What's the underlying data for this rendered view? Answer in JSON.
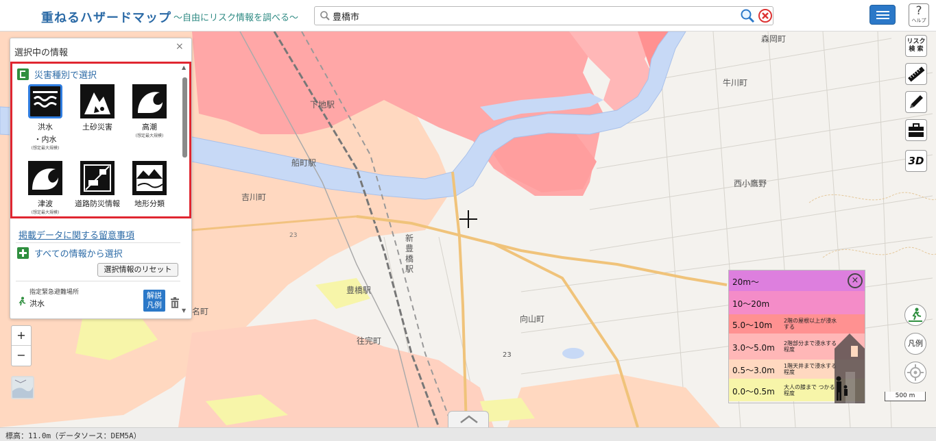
{
  "header": {
    "title": "重ねるハザードマップ",
    "subtitle": "～自由にリスク情報を調べる～",
    "search_value": "豊橋市",
    "help_label": "ヘルプ"
  },
  "panel": {
    "title": "選択中の情報",
    "close_label": "×",
    "by_type_heading": "災害種別で選択",
    "hazards": [
      {
        "label": "洪水",
        "label2": "・内水",
        "note": "(想定最大規模)"
      },
      {
        "label": "土砂災害",
        "label2": "",
        "note": ""
      },
      {
        "label": "高潮",
        "label2": "",
        "note": "(想定最大規模)"
      },
      {
        "label": "津波",
        "label2": "",
        "note": "(想定最大規模)"
      },
      {
        "label": "道路防災情報",
        "label2": "",
        "note": ""
      },
      {
        "label": "地形分類",
        "label2": "",
        "note": ""
      }
    ],
    "notice_link": "掲載データに関する留意事項",
    "all_heading": "すべての情報から選択",
    "reset_label": "選択情報のリセット",
    "layer": {
      "category": "指定緊急避難場所",
      "name": "洪水",
      "legend_label_1": "解説",
      "legend_label_2": "凡例"
    }
  },
  "zoom": {
    "in": "+",
    "out": "−"
  },
  "tools": {
    "risk_search_line1": "リスク",
    "risk_search_line2": "検 索",
    "three_d": "3D",
    "hanrei": "凡例"
  },
  "map_labels": {
    "morioka": "森岡町",
    "ushikawa": "牛川町",
    "nishikotakano": "西小鷹野",
    "yoshikawa": "吉川町",
    "toyohashi_station": "豊橋駅",
    "mukaiyama": "向山町",
    "oguchi": "往完町",
    "shimoji": "下地駅",
    "funamachi": "船町駅",
    "shin_toyohashi": "新豊橋駅",
    "na": "名町",
    "route_23": "23",
    "route_23b": "23"
  },
  "depth_legend": {
    "rows": [
      {
        "range": "20m～",
        "desc": "",
        "color": "#dd7fde"
      },
      {
        "range": "10～20m",
        "desc": "",
        "color": "#f48cc8"
      },
      {
        "range": "5.0～10m",
        "desc": "2階の屋根以上が浸水する",
        "color": "#ff9191"
      },
      {
        "range": "3.0～5.0m",
        "desc": "2階部分まで浸水する程度",
        "color": "#ffb7b7"
      },
      {
        "range": "0.5～3.0m",
        "desc": "1階天井まで浸水する程度",
        "color": "#ffd8c0"
      },
      {
        "range": "0.0～0.5m",
        "desc": "大人の膝まで つかる程度",
        "color": "#f7f5a9"
      }
    ],
    "close_label": "×"
  },
  "scale_label": "500 m",
  "status_text": "標高：11.0m（データソース：DEM5A）"
}
